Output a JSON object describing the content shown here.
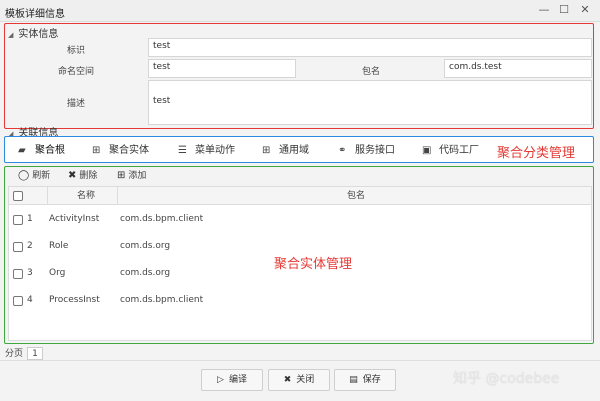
{
  "window": {
    "title": "模板详细信息"
  },
  "entity_section": {
    "header": "实体信息",
    "label_id": "标识",
    "value_id": "test",
    "label_ns": "命名空间",
    "value_ns": "test",
    "label_pkg": "包名",
    "value_pkg": "com.ds.test",
    "label_desc": "描述",
    "value_desc": "test"
  },
  "related_section": {
    "header": "关联信息"
  },
  "tabs": [
    {
      "label": "聚合根",
      "icon": "aggregate-root-icon"
    },
    {
      "label": "聚合实体",
      "icon": "grid-icon"
    },
    {
      "label": "菜单动作",
      "icon": "menu-icon"
    },
    {
      "label": "通用域",
      "icon": "grid-icon"
    },
    {
      "label": "服务接口",
      "icon": "link-icon"
    },
    {
      "label": "代码工厂",
      "icon": "code-factory-icon"
    }
  ],
  "annotations": {
    "tabs_note": "聚合分类管理",
    "grid_note": "聚合实体管理"
  },
  "toolbar": {
    "refresh": "刷新",
    "delete": "删除",
    "add": "添加"
  },
  "grid": {
    "col_name": "名称",
    "col_pkg": "包名",
    "rows": [
      {
        "idx": "1",
        "name": "ActivityInst",
        "pkg": "com.ds.bpm.client"
      },
      {
        "idx": "2",
        "name": "Role",
        "pkg": "com.ds.org"
      },
      {
        "idx": "3",
        "name": "Org",
        "pkg": "com.ds.org"
      },
      {
        "idx": "4",
        "name": "ProcessInst",
        "pkg": "com.ds.bpm.client"
      }
    ]
  },
  "pager": {
    "label": "分页",
    "page": "1"
  },
  "buttons": {
    "edit": "编译",
    "close": "关闭",
    "save": "保存"
  },
  "watermark": "知乎 @codebee"
}
